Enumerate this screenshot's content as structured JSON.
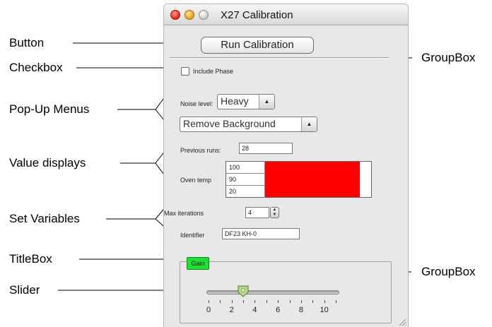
{
  "annotations": {
    "button": "Button",
    "checkbox": "Checkbox",
    "popup_menus": "Pop-Up Menus",
    "value_displays": "Value displays",
    "set_variables": "Set Variables",
    "titlebox": "TitleBox",
    "slider": "Slider",
    "groupbox_top": "GroupBox",
    "groupbox_bottom": "GroupBox"
  },
  "window": {
    "title": "X27 Calibration"
  },
  "controls": {
    "run_button": "Run Calibration",
    "include_phase": {
      "label": "Include Phase",
      "checked": false
    },
    "noise_label": "Noise level:",
    "noise_value": "Heavy",
    "background_value": "Remove Background",
    "previous_runs_label": "Previous runs:",
    "previous_runs_value": "28",
    "oven_temp_label": "Oven temp",
    "oven_temp_values": [
      "100",
      "90",
      "20"
    ],
    "oven_swatch_color": "#ff0000",
    "max_iterations_label": "Max iterations",
    "max_iterations_value": "4",
    "identifier_label": "Identifier",
    "identifier_value": "DF23 KH-0",
    "gain_title": "Gain",
    "gain_color": "#22dd33",
    "slider": {
      "min": 0,
      "max": 11,
      "value": 2,
      "tick_labels": [
        "0",
        "2",
        "4",
        "6",
        "8",
        "10"
      ]
    }
  }
}
